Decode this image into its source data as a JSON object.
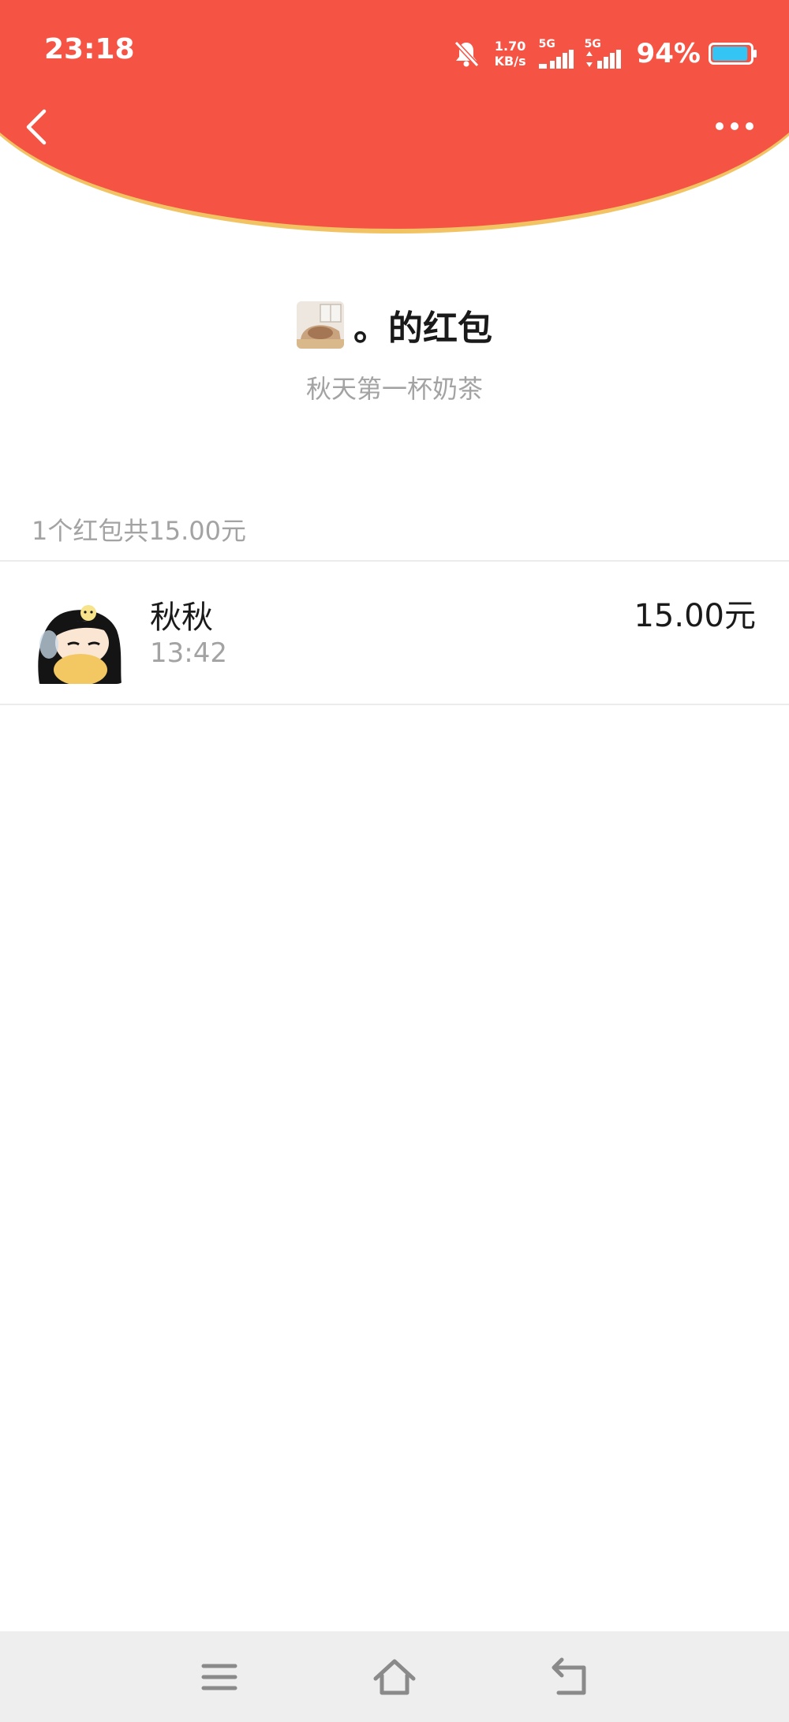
{
  "colors": {
    "header_red": "#F55445",
    "header_edge": "#F2C363",
    "muted_text": "#A3A3A3"
  },
  "status_bar": {
    "time": "23:18",
    "net_speed_value": "1.70",
    "net_speed_unit": "KB/s",
    "sim1_label": "5G",
    "sim2_label": "5G",
    "battery_percent": "94%",
    "battery_level": 0.94
  },
  "toolbar": {
    "back_icon": "chevron-left-icon",
    "more_icon": "more-dots-icon"
  },
  "envelope": {
    "sender_name": "。的红包",
    "message": "秋天第一杯奶茶",
    "summary": "1个红包共15.00元"
  },
  "claims": [
    {
      "name": "秋秋",
      "time": "13:42",
      "amount": "15.00元"
    }
  ],
  "nav_bar": {
    "icons": [
      "menu-icon",
      "home-icon",
      "back-icon"
    ]
  }
}
